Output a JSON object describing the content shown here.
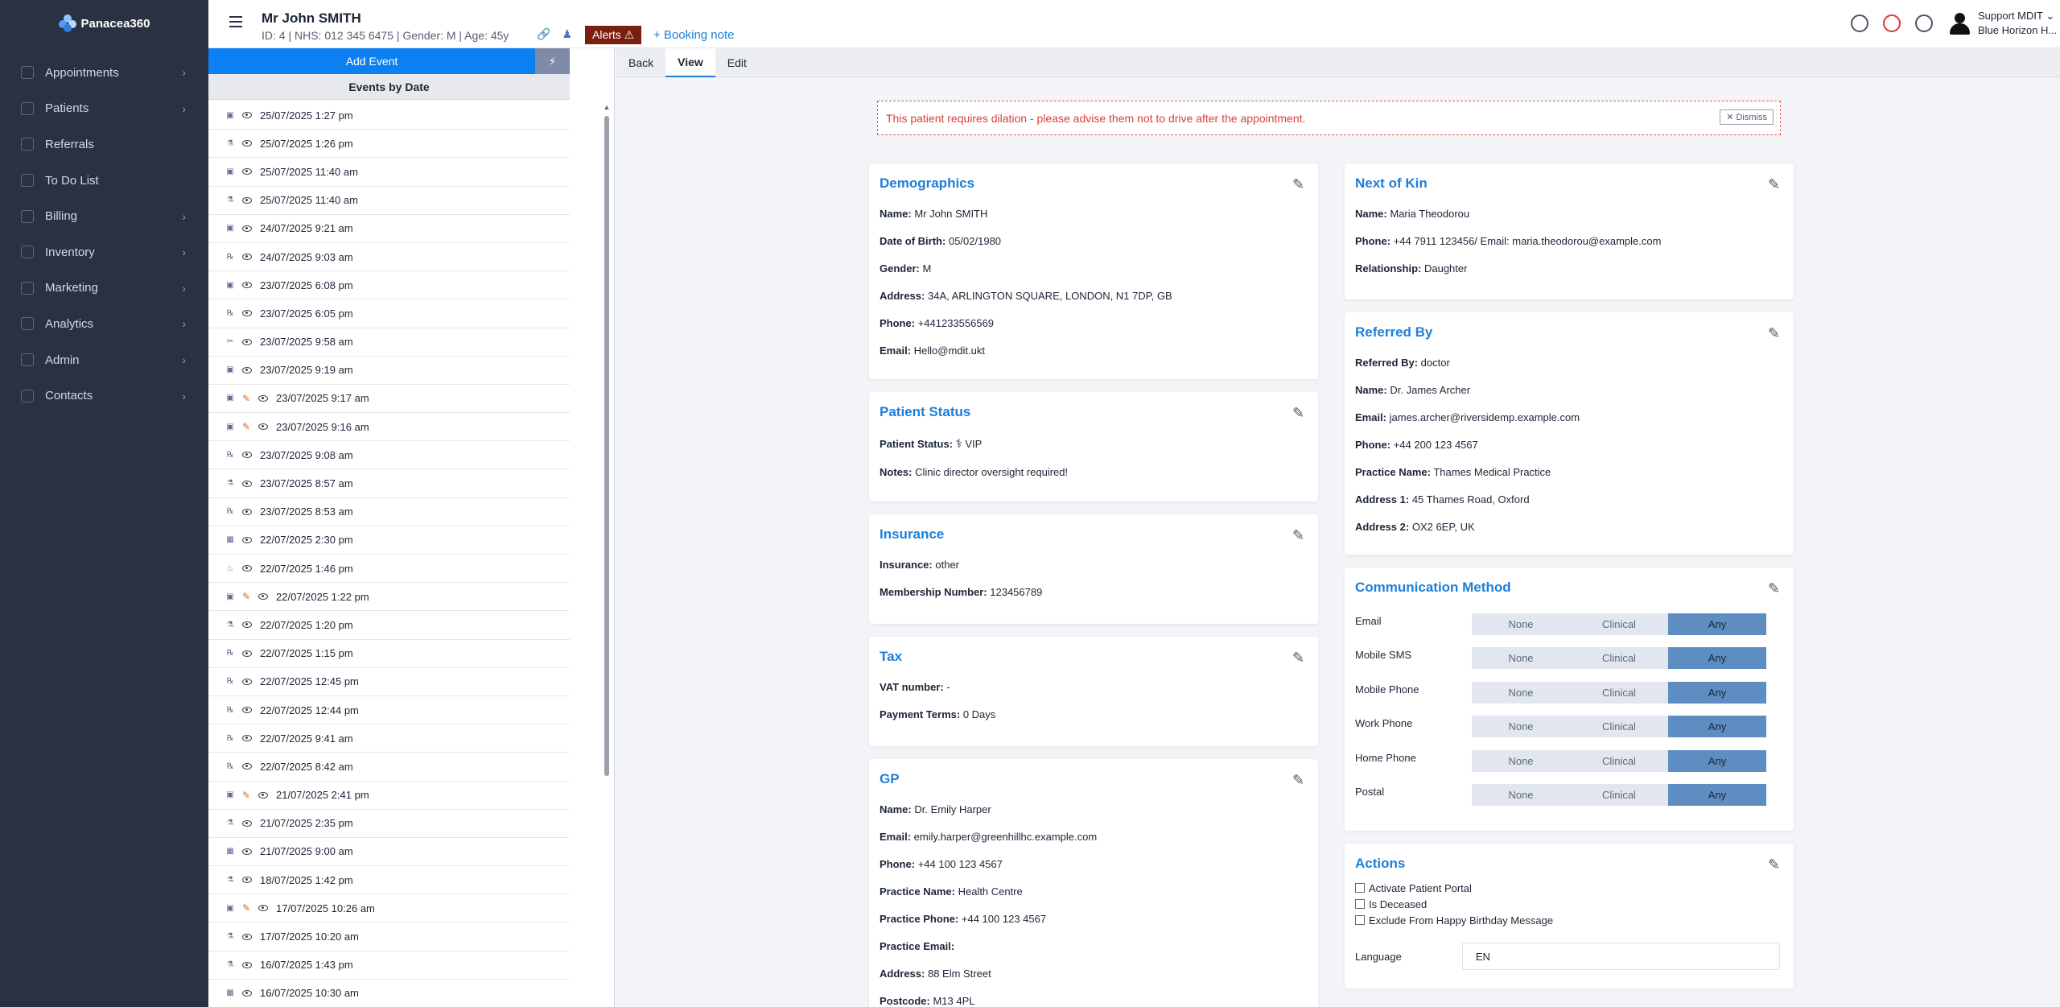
{
  "app": {
    "name": "Panacea360"
  },
  "nav": [
    {
      "label": "Appointments",
      "icon": "calendar-icon",
      "chevron": true
    },
    {
      "label": "Patients",
      "icon": "users-icon",
      "chevron": true
    },
    {
      "label": "Referrals",
      "icon": "referral-icon",
      "chevron": false
    },
    {
      "label": "To Do List",
      "icon": "list-icon",
      "chevron": false
    },
    {
      "label": "Billing",
      "icon": "invoice-icon",
      "chevron": true
    },
    {
      "label": "Inventory",
      "icon": "box-icon",
      "chevron": true
    },
    {
      "label": "Marketing",
      "icon": "megaphone-icon",
      "chevron": true
    },
    {
      "label": "Analytics",
      "icon": "chart-icon",
      "chevron": true
    },
    {
      "label": "Admin",
      "icon": "gear-icon",
      "chevron": true
    },
    {
      "label": "Contacts",
      "icon": "address-book-icon",
      "chevron": true
    }
  ],
  "header": {
    "patient_name": "Mr John SMITH",
    "patient_meta": "ID: 4 | NHS: 012 345 6475 | Gender: M | Age: 45y",
    "alerts_label": "Alerts ⚠",
    "booking_note": "+ Booking note",
    "user_name": "Support MDIT",
    "user_org": "Blue Horizon H..."
  },
  "events": {
    "add_label": "Add Event",
    "heading": "Events by Date",
    "rows": [
      {
        "date": "25/07/2025 1:27 pm",
        "type": "image-icon",
        "pen": false
      },
      {
        "date": "25/07/2025 1:26 pm",
        "type": "flask-icon",
        "pen": false
      },
      {
        "date": "25/07/2025 11:40 am",
        "type": "image-icon",
        "pen": false
      },
      {
        "date": "25/07/2025 11:40 am",
        "type": "flask-icon",
        "pen": false
      },
      {
        "date": "24/07/2025 9:21 am",
        "type": "image-icon",
        "pen": false
      },
      {
        "date": "24/07/2025 9:03 am",
        "type": "rx-icon",
        "pen": false
      },
      {
        "date": "23/07/2025 6:08 pm",
        "type": "image-icon",
        "pen": false
      },
      {
        "date": "23/07/2025 6:05 pm",
        "type": "rx-icon",
        "pen": false
      },
      {
        "date": "23/07/2025 9:58 am",
        "type": "scissors-icon",
        "pen": false
      },
      {
        "date": "23/07/2025 9:19 am",
        "type": "image-icon",
        "pen": false
      },
      {
        "date": "23/07/2025 9:17 am",
        "type": "image-icon",
        "pen": true
      },
      {
        "date": "23/07/2025 9:16 am",
        "type": "image-icon",
        "pen": true
      },
      {
        "date": "23/07/2025 9:08 am",
        "type": "rx-icon",
        "pen": false
      },
      {
        "date": "23/07/2025 8:57 am",
        "type": "flask-icon",
        "pen": false
      },
      {
        "date": "23/07/2025 8:53 am",
        "type": "rx-icon",
        "pen": false
      },
      {
        "date": "22/07/2025 2:30 pm",
        "type": "calendar-icon",
        "pen": false
      },
      {
        "date": "22/07/2025 1:46 pm",
        "type": "fire-icon",
        "pen": false
      },
      {
        "date": "22/07/2025 1:22 pm",
        "type": "image-icon",
        "pen": true
      },
      {
        "date": "22/07/2025 1:20 pm",
        "type": "flask-icon",
        "pen": false
      },
      {
        "date": "22/07/2025 1:15 pm",
        "type": "rx-icon",
        "pen": false
      },
      {
        "date": "22/07/2025 12:45 pm",
        "type": "rx-icon",
        "pen": false
      },
      {
        "date": "22/07/2025 12:44 pm",
        "type": "rx-icon",
        "pen": false
      },
      {
        "date": "22/07/2025 9:41 am",
        "type": "rx-icon",
        "pen": false
      },
      {
        "date": "22/07/2025 8:42 am",
        "type": "rx-icon",
        "pen": false
      },
      {
        "date": "21/07/2025 2:41 pm",
        "type": "image-icon",
        "pen": true
      },
      {
        "date": "21/07/2025 2:35 pm",
        "type": "flask-icon",
        "pen": false
      },
      {
        "date": "21/07/2025 9:00 am",
        "type": "calendar-icon",
        "pen": false
      },
      {
        "date": "18/07/2025 1:42 pm",
        "type": "flask-icon",
        "pen": false
      },
      {
        "date": "17/07/2025 10:26 am",
        "type": "image-icon",
        "pen": true
      },
      {
        "date": "17/07/2025 10:20 am",
        "type": "flask-icon",
        "pen": false
      },
      {
        "date": "16/07/2025 1:43 pm",
        "type": "flask-icon",
        "pen": false
      },
      {
        "date": "16/07/2025 10:30 am",
        "type": "calendar-icon",
        "pen": false
      }
    ]
  },
  "tabs": [
    "Back",
    "View",
    "Edit"
  ],
  "active_tab": "View",
  "banner": {
    "text": "This patient requires dilation - please advise them not to drive after the appointment.",
    "dismiss": "✕ Dismiss"
  },
  "demographics": {
    "title": "Demographics",
    "fields": [
      {
        "k": "Name:",
        "v": "Mr John SMITH"
      },
      {
        "k": "Date of Birth:",
        "v": "05/02/1980"
      },
      {
        "k": "Gender:",
        "v": "M"
      },
      {
        "k": "Address:",
        "v": "34A, ARLINGTON SQUARE, LONDON, N1 7DP, GB"
      },
      {
        "k": "Phone:",
        "v": "+441233556569"
      },
      {
        "k": "Email:",
        "v": "Hello@mdit.ukt"
      }
    ]
  },
  "patient_status": {
    "title": "Patient Status",
    "fields": [
      {
        "k": "Patient Status:",
        "v": "VIP"
      },
      {
        "k": "Notes:",
        "v": "Clinic director oversight required!"
      }
    ]
  },
  "insurance": {
    "title": "Insurance",
    "fields": [
      {
        "k": "Insurance:",
        "v": "other"
      },
      {
        "k": "Membership Number:",
        "v": "123456789"
      }
    ]
  },
  "tax": {
    "title": "Tax",
    "fields": [
      {
        "k": "VAT number:",
        "v": "-"
      },
      {
        "k": "Payment Terms:",
        "v": "0 Days"
      }
    ]
  },
  "gp": {
    "title": "GP",
    "fields": [
      {
        "k": "Name:",
        "v": "Dr. Emily Harper"
      },
      {
        "k": "Email:",
        "v": "emily.harper@greenhillhc.example.com"
      },
      {
        "k": "Phone:",
        "v": "+44 100 123 4567"
      },
      {
        "k": "Practice Name:",
        "v": "Health Centre"
      },
      {
        "k": "Practice Phone:",
        "v": "+44 100 123 4567"
      },
      {
        "k": "Practice Email:",
        "v": ""
      },
      {
        "k": "Address:",
        "v": "88 Elm Street"
      },
      {
        "k": "Postcode:",
        "v": "M13 4PL"
      }
    ]
  },
  "next_of_kin": {
    "title": "Next of Kin",
    "fields": [
      {
        "k": "Name:",
        "v": "Maria Theodorou"
      },
      {
        "k": "Phone:",
        "v": "+44 7911 123456/ Email: maria.theodorou@example.com"
      },
      {
        "k": "Relationship:",
        "v": "Daughter"
      }
    ]
  },
  "referred_by": {
    "title": "Referred By",
    "fields": [
      {
        "k": "Referred By:",
        "v": "doctor"
      },
      {
        "k": "Name:",
        "v": "Dr. James Archer"
      },
      {
        "k": "Email:",
        "v": "james.archer@riversidemp.example.com"
      },
      {
        "k": "Phone:",
        "v": "+44 200 123 4567"
      },
      {
        "k": "Practice Name:",
        "v": "Thames Medical Practice"
      },
      {
        "k": "Address 1:",
        "v": "45 Thames Road, Oxford"
      },
      {
        "k": "Address 2:",
        "v": "OX2 6EP, UK"
      }
    ]
  },
  "communication": {
    "title": "Communication Method",
    "options": [
      "None",
      "Clinical",
      "Any"
    ],
    "rows": [
      {
        "label": "Email",
        "selected": "Any"
      },
      {
        "label": "Mobile SMS",
        "selected": "Any"
      },
      {
        "label": "Mobile Phone",
        "selected": "Any"
      },
      {
        "label": "Work Phone",
        "selected": "Any"
      },
      {
        "label": "Home Phone",
        "selected": "Any"
      },
      {
        "label": "Postal",
        "selected": "Any"
      }
    ]
  },
  "actions": {
    "title": "Actions",
    "checks": [
      {
        "label": "Activate Patient Portal",
        "checked": false
      },
      {
        "label": "Is Deceased",
        "checked": false
      },
      {
        "label": "Exclude From Happy Birthday Message",
        "checked": false
      }
    ],
    "language_label": "Language",
    "language_value": "EN"
  },
  "colors": {
    "primary": "#0c7ff2",
    "sidebar": "#2a3143",
    "alert": "#7a1e0f",
    "selected_segment": "#5d8dc1"
  }
}
